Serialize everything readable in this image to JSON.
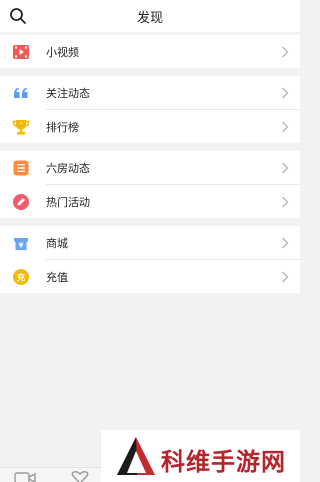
{
  "header": {
    "title": "发现",
    "search_icon": "search-icon"
  },
  "groups": [
    {
      "items": [
        {
          "label": "小视频",
          "icon": "video-icon",
          "color": "#f25a5a"
        }
      ]
    },
    {
      "items": [
        {
          "label": "关注动态",
          "icon": "quote-icon",
          "color": "#5b9cf0"
        },
        {
          "label": "排行榜",
          "icon": "trophy-icon",
          "color": "#f5b800"
        }
      ]
    },
    {
      "items": [
        {
          "label": "六房动态",
          "icon": "list-icon",
          "color": "#ff8a3c"
        },
        {
          "label": "热门活动",
          "icon": "pencil-icon",
          "color": "#f25a6e"
        }
      ]
    },
    {
      "items": [
        {
          "label": "商城",
          "icon": "shop-icon",
          "color": "#6aa5f2"
        },
        {
          "label": "充值",
          "icon": "recharge-icon",
          "color": "#f5b800"
        }
      ]
    }
  ],
  "shop_icon_glyph": "¥",
  "recharge_icon_glyph": "充",
  "watermark": {
    "text": "科维手游网"
  }
}
